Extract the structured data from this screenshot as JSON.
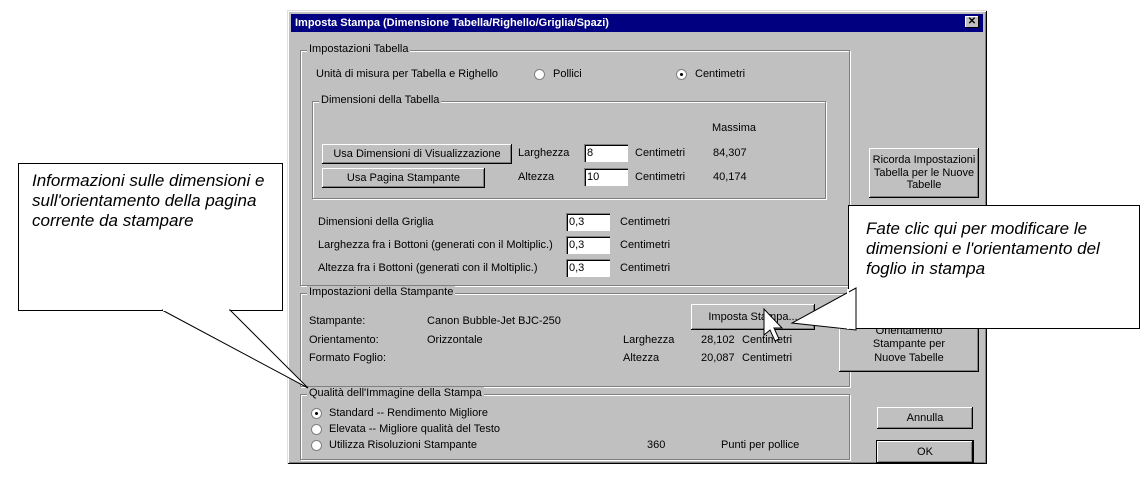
{
  "dialog": {
    "title": "Imposta Stampa (Dimensione Tabella/Righello/Griglia/Spazi)",
    "close": "✕"
  },
  "table_settings": {
    "group_label": "Impostazioni Tabella",
    "unit_label": "Unità di misura per Tabella e Righello",
    "unit_options": [
      "Pollici",
      "Centimetri"
    ],
    "unit_selected": "Centimetri",
    "dimensions": {
      "group_label": "Dimensioni della Tabella",
      "max_header": "Massima",
      "use_view_button": "Usa Dimensioni di Visualizzazione",
      "use_page_button": "Usa Pagina Stampante",
      "width_label": "Larghezza",
      "width_value": "8",
      "height_label": "Altezza",
      "height_value": "10",
      "unit": "Centimetri",
      "max_width": "84,307",
      "max_height": "40,174"
    },
    "grid_label": "Dimensioni della Griglia",
    "grid_value": "0,3",
    "btn_width_label": "Larghezza fra i Bottoni (generati con il Moltiplic.)",
    "btn_width_value": "0,3",
    "btn_height_label": "Altezza fra i Bottoni (generati con il Moltiplic.)",
    "btn_height_value": "0,3",
    "unit": "Centimetri"
  },
  "printer_settings": {
    "group_label": "Impostazioni della Stampante",
    "printer_label": "Stampante:",
    "printer_value": "Canon Bubble-Jet BJC-250",
    "orientation_label": "Orientamento:",
    "orientation_value": "Orizzontale",
    "format_label": "Formato Foglio:",
    "width_label": "Larghezza",
    "width_value": "28,102",
    "height_label": "Altezza",
    "height_value": "20,087",
    "unit": "Centimetri",
    "setup_button": "Imposta Stampa..."
  },
  "quality": {
    "group_label": "Qualità dell'Immagine della Stampa",
    "options": [
      "Standard  -- Rendimento Migliore",
      "Elevata  --  Migliore qualità del Testo",
      "Utilizza Risoluzioni Stampante"
    ],
    "selected_index": 0,
    "dpi_value": "360",
    "dpi_label": "Punti per pollice"
  },
  "side_buttons": {
    "remember_table": "Ricorda Impostazioni Tabella per le Nuove Tabelle",
    "remember_printer_partial": "Orientamento",
    "remember_printer_rest": "Stampante per Nuove Tabelle",
    "cancel": "Annulla",
    "ok": "OK"
  },
  "callouts": {
    "left": "Informazioni sulle dimensioni e sull'orientamento della pagina corrente da stampare",
    "right": "Fate clic qui per modificare le dimensioni e l'orientamento del foglio in stampa"
  }
}
